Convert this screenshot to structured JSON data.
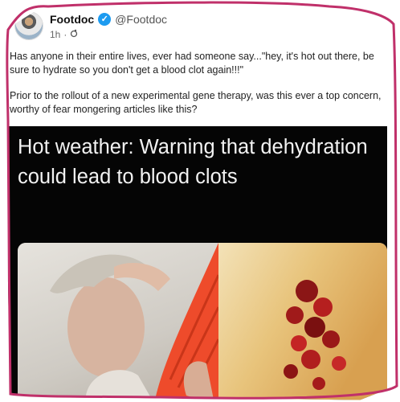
{
  "post": {
    "author": {
      "display_name": "Footdoc",
      "handle": "@Footdoc",
      "verified": true
    },
    "time": "1h",
    "separator": "·",
    "paragraphs": [
      "Has anyone in their entire lives, ever had someone say...\"hey, it's hot out there, be sure to hydrate so you don't get a blood clot again!!!\"",
      "Prior to the rollout of a new experimental gene therapy, was this ever a top concern, worthy of fear mongering articles like this?"
    ]
  },
  "article": {
    "headline": "Hot weather: Warning that dehydration could lead to blood clots"
  },
  "icons": {
    "verified": "verified-badge-icon",
    "audience": "globe-icon"
  },
  "colors": {
    "border": "#c0306a",
    "verified": "#1d9bf0",
    "card_background": "#050505"
  }
}
